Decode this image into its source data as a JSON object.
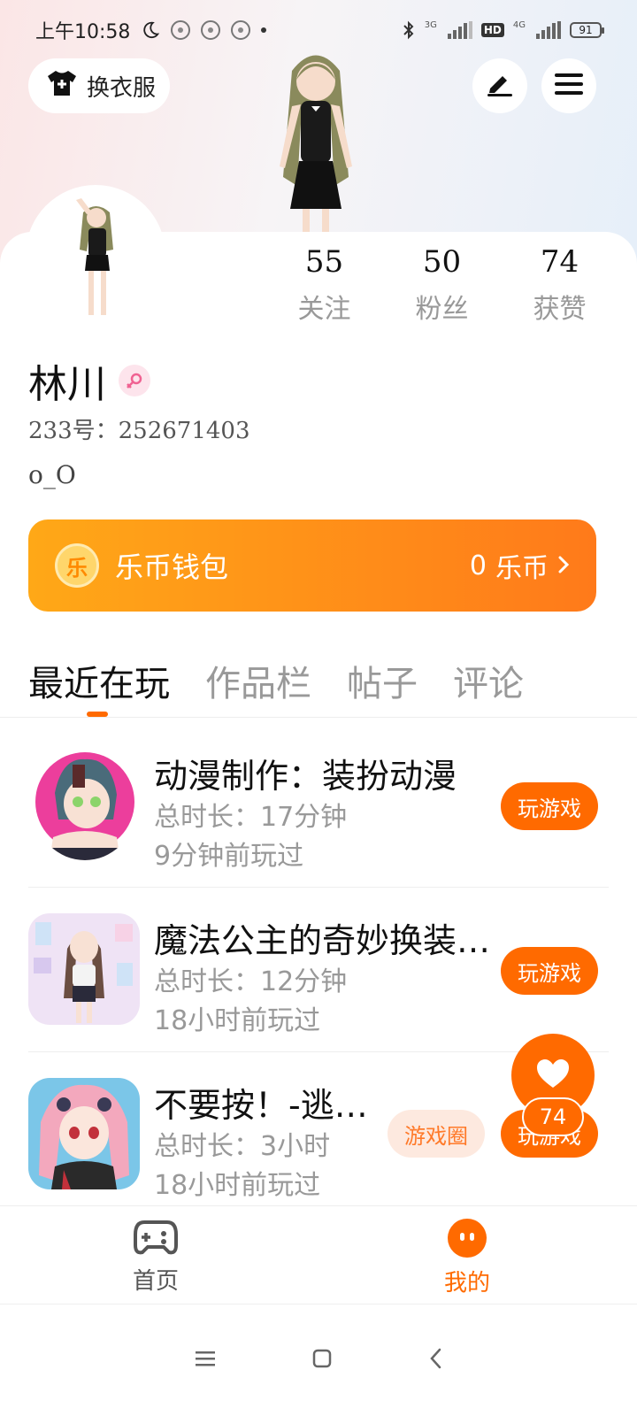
{
  "status_bar": {
    "time": "上午10:58",
    "battery": "91",
    "network_3g": "3G",
    "network_4g": "4G",
    "hd": "HD"
  },
  "header": {
    "dress_up_label": "换衣服"
  },
  "stats": [
    {
      "value": "55",
      "label": "关注"
    },
    {
      "value": "50",
      "label": "粉丝"
    },
    {
      "value": "74",
      "label": "获赞"
    }
  ],
  "profile": {
    "username": "林川",
    "uid": "233号：252671403",
    "bio": "o_O"
  },
  "wallet": {
    "coin_glyph": "乐",
    "title": "乐币钱包",
    "balance": "0",
    "unit": "乐币"
  },
  "tabs": [
    {
      "label": "最近在玩",
      "active": true
    },
    {
      "label": "作品栏",
      "active": false
    },
    {
      "label": "帖子",
      "active": false
    },
    {
      "label": "评论",
      "active": false
    }
  ],
  "games": [
    {
      "name": "动漫制作：装扮动漫",
      "duration": "总时长：17分钟",
      "last_played": "9分钟前玩过",
      "play_label": "玩游戏"
    },
    {
      "name": "魔法公主的奇妙换装…",
      "duration": "总时长：12分钟",
      "last_played": "18小时前玩过",
      "play_label": "玩游戏"
    },
    {
      "name": "不要按！-逃…",
      "duration": "总时长：3小时",
      "last_played": "18小时前玩过",
      "play_label": "玩游戏",
      "circle_label": "游戏圈"
    }
  ],
  "fab": {
    "count": "74"
  },
  "bottom_nav": [
    {
      "label": "首页",
      "icon": "gamepad-icon",
      "active": false
    },
    {
      "label": "我的",
      "icon": "face-icon",
      "active": true
    }
  ],
  "colors": {
    "accent": "#ff6a00",
    "wallet_start": "#ffa817",
    "wallet_end": "#ff7a1a"
  }
}
